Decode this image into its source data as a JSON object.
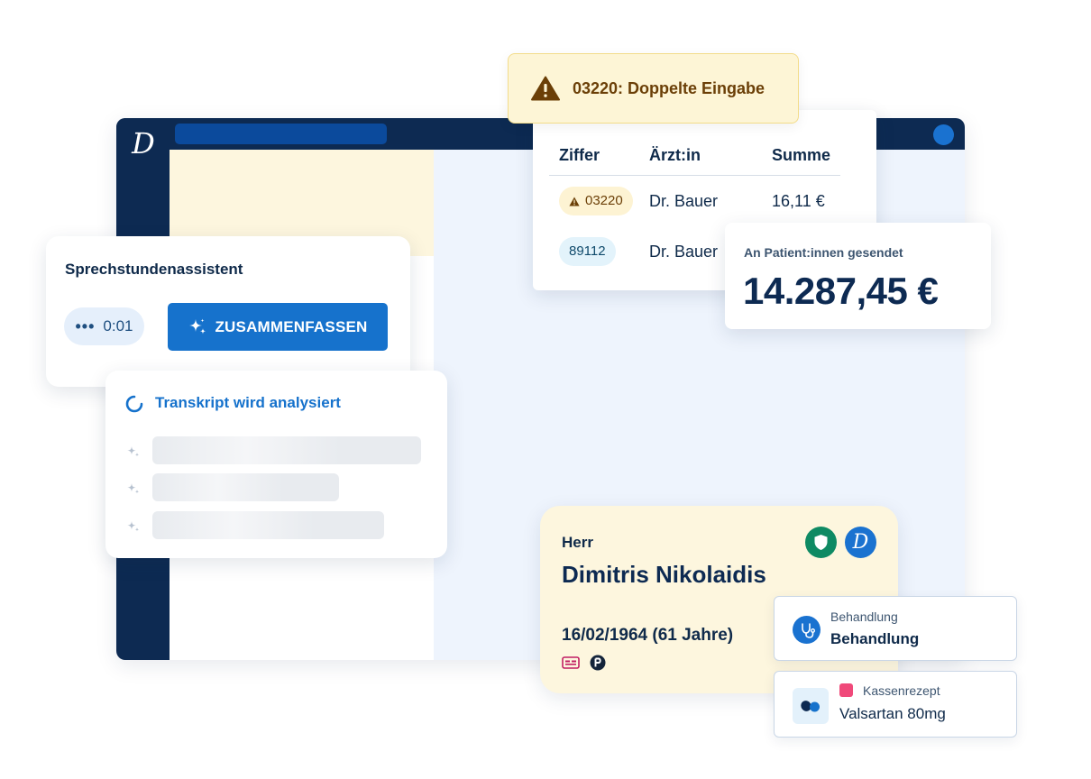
{
  "app": {
    "logo_letter": "D"
  },
  "warning": {
    "text": "03220: Doppelte Eingabe",
    "icon": "warning-triangle-icon"
  },
  "billing_table": {
    "headers": [
      "Ziffer",
      "Ärzt:in",
      "Summe"
    ],
    "rows": [
      {
        "code": "03220",
        "status": "warning",
        "doctor": "Dr. Bauer",
        "sum": "16,11 €"
      },
      {
        "code": "89112",
        "status": "ok",
        "doctor": "Dr. Bauer",
        "sum": ""
      }
    ]
  },
  "sent": {
    "label": "An Patient:innen gesendet",
    "amount": "14.287,45 €"
  },
  "assistant": {
    "title": "Sprechstundenassistent",
    "timer_dots": "•••",
    "timer": "0:01",
    "summarize_label": "ZUSAMMENFASSEN"
  },
  "transcript": {
    "status": "Transkript wird analysiert"
  },
  "patient": {
    "salutation": "Herr",
    "name": "Dimitris Nikolaidis",
    "dob": "16/02/1964 (61 Jahre)",
    "logo_letter": "D"
  },
  "treatment": {
    "category": "Behandlung",
    "title": "Behandlung"
  },
  "prescription": {
    "category": "Kassenrezept",
    "title": "Valsartan 80mg",
    "marker_color": "#f0497a"
  },
  "colors": {
    "navy": "#0d2a52",
    "primary": "#1672cc",
    "warning_bg": "#fdf5d6",
    "patient_bg": "#fdf6de",
    "panel_blue": "#eef4fd",
    "shield_green": "#0e8a63"
  }
}
